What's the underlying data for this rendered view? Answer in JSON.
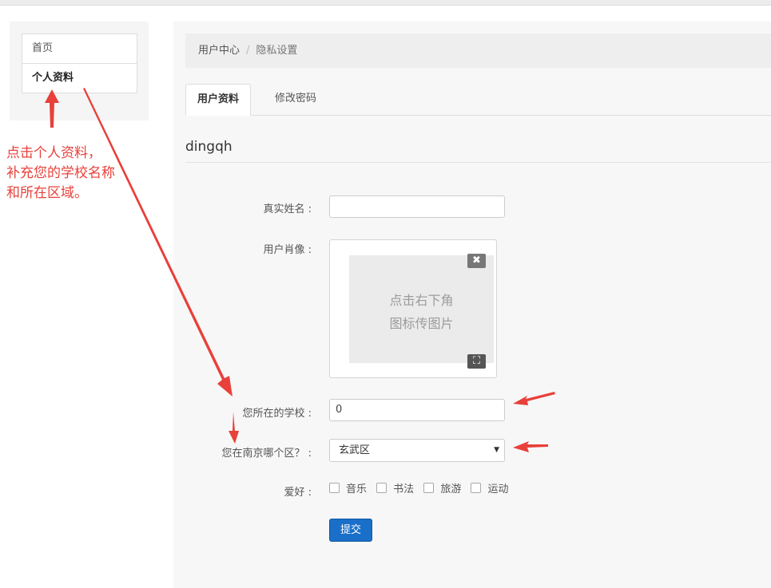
{
  "sidebar": {
    "items": [
      {
        "label": "首页"
      },
      {
        "label": "个人资料"
      }
    ]
  },
  "breadcrumb": {
    "items": [
      "用户中心",
      "隐私设置"
    ],
    "separator": "/"
  },
  "tabs": [
    {
      "label": "用户资料",
      "active": true
    },
    {
      "label": "修改密码",
      "active": false
    }
  ],
  "username": "dingqh",
  "form": {
    "real_name": {
      "label": "真实姓名 :",
      "value": ""
    },
    "avatar": {
      "label": "用户肖像 :",
      "placeholder_lines": [
        "点击右下角",
        "图标传图片"
      ],
      "close_glyph": "✖",
      "upload_glyph": "⛶"
    },
    "school": {
      "label": "您所在的学校 :",
      "value": "0"
    },
    "district": {
      "label": "您在南京哪个区？ :",
      "selected": "玄武区",
      "caret": "▼"
    },
    "hobbies": {
      "label": "爱好 :",
      "options": [
        "音乐",
        "书法",
        "旅游",
        "运动"
      ]
    },
    "submit_label": "提交"
  },
  "annotation": {
    "lines": [
      "点击个人资料，",
      "补充您的学校名称",
      "和所在区域。"
    ],
    "color": "#e8403a"
  },
  "colors": {
    "primary_button": "#1a6fc9",
    "annotation_red": "#e8403a"
  }
}
